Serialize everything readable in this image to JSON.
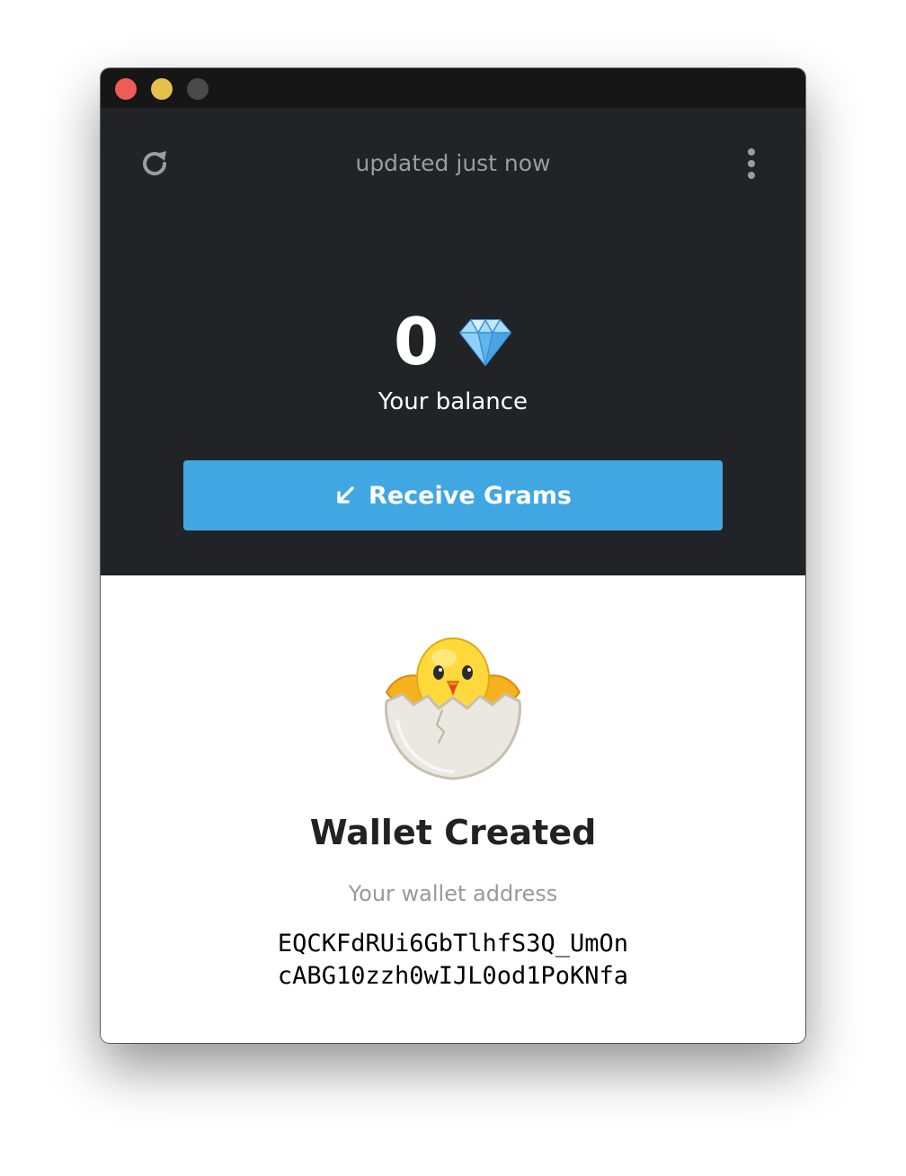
{
  "window": {
    "controls": [
      "close",
      "minimize",
      "maximize"
    ]
  },
  "header": {
    "refresh_icon": "refresh-icon",
    "updated_text": "updated just now",
    "menu_icon": "more-vertical-icon"
  },
  "balance": {
    "value": "0",
    "currency_icon": "diamond-icon",
    "label": "Your balance"
  },
  "receive_button": {
    "icon": "arrow-down-left-icon",
    "label": "Receive Grams"
  },
  "wallet": {
    "illustration": "hatching-chick-icon",
    "title": "Wallet Created",
    "address_label": "Your wallet address",
    "address_line1": "EQCKFdRUi6GbTlhfS3Q_UmOn",
    "address_line2": "cABG10zzh0wIJL0od1PoKNfa"
  },
  "colors": {
    "header_bg": "#222326",
    "accent": "#40a7e3",
    "muted_text": "#9b9c9e"
  }
}
